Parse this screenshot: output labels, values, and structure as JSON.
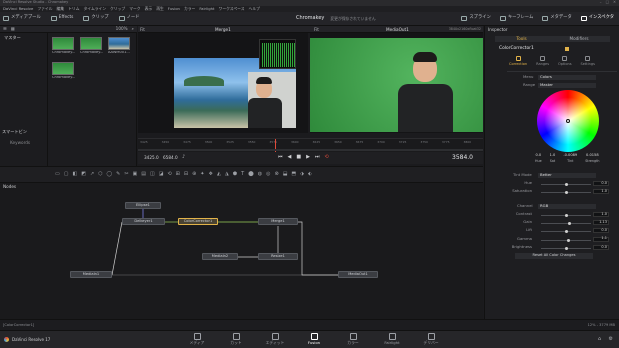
{
  "window": {
    "title": "DaVinci Resolve Studio - Chromakey",
    "controls": [
      "–",
      "□",
      "✕"
    ]
  },
  "menu": {
    "items": [
      "DaVinci Resolve",
      "ファイル",
      "編集",
      "トリム",
      "タイムライン",
      "クリップ",
      "マーク",
      "表示",
      "再生",
      "Fusion",
      "カラー",
      "Fairlight",
      "ワークスペース",
      "ヘルプ"
    ]
  },
  "toolbar": {
    "left": [
      {
        "label": "メディアプール",
        "icon": "media-pool-icon"
      },
      {
        "label": "Effects",
        "icon": "effects-icon"
      },
      {
        "label": "クリップ",
        "icon": "clips-icon"
      },
      {
        "label": "ノード",
        "icon": "nodes-icon"
      }
    ],
    "project_name": "Chromakey",
    "project_status": "変更が保存されていません",
    "right": [
      {
        "label": "スプライン",
        "icon": "spline-icon"
      },
      {
        "label": "キーフレーム",
        "icon": "keyframes-icon"
      },
      {
        "label": "メタデータ",
        "icon": "metadata-icon"
      },
      {
        "label": "インスペクタ",
        "icon": "inspector-icon"
      }
    ]
  },
  "mediapool": {
    "header_zoom": "100%",
    "bin_master": "マスター",
    "bin_smart": "スマートビン",
    "smart_keywords": "Keywords",
    "clips": [
      {
        "name": "Chromakey...",
        "thumb": "green"
      },
      {
        "name": "Chromakey...",
        "thumb": "green"
      },
      {
        "name": "AAWM001...",
        "thumb": "ocean"
      },
      {
        "name": "Chromakey...",
        "thumb": "green"
      }
    ]
  },
  "viewers": {
    "left_title": "Merge1",
    "right_title": "MediaOut1",
    "zoom_left": "Fit",
    "zoom_right": "Fit",
    "resolution": "3840x2160xfloat32"
  },
  "timeline": {
    "ticks": [
      "3425",
      "3450",
      "3475",
      "3500",
      "3525",
      "3550",
      "3575",
      "3600",
      "3625",
      "3650",
      "3675",
      "3700",
      "3725",
      "3750",
      "3775",
      "3800"
    ],
    "current_time": "3584.0",
    "start": "3425.0",
    "end": "6584.0"
  },
  "nodes": {
    "title": "Nodes",
    "items": [
      {
        "name": "Ellipse1"
      },
      {
        "name": "Delkeyer1"
      },
      {
        "name": "ColorCorrector1",
        "selected": true
      },
      {
        "name": "Merge1"
      },
      {
        "name": "MediaIn2"
      },
      {
        "name": "Resize1"
      },
      {
        "name": "MediaIn1"
      },
      {
        "name": "MediaOut1"
      }
    ]
  },
  "inspector": {
    "title": "Inspector",
    "tab_tools": "Tools",
    "tab_modifiers": "Modifiers",
    "node_name": "ColorCorrector1",
    "subtabs": [
      "Correction",
      "Ranges",
      "Options",
      "Settings"
    ],
    "menu_label": "Menu",
    "menu_value": "Colors",
    "range_label": "Range",
    "range_value": "Master",
    "wheel_values": [
      {
        "label": "Hue",
        "value": "0.0"
      },
      {
        "label": "Sat",
        "value": "1.0"
      },
      {
        "label": "Tint",
        "value": "-0.0089"
      },
      {
        "label": "Strength",
        "value": "0.0158"
      }
    ],
    "tint_mode": {
      "label": "Tint Mode",
      "value": "Better"
    },
    "sliders1": [
      {
        "label": "Hue",
        "value": "0.0",
        "level": 0.5
      },
      {
        "label": "Saturation",
        "value": "1.0",
        "level": 0.5
      }
    ],
    "channel": {
      "label": "Channel",
      "value": "RGB"
    },
    "sliders2": [
      {
        "label": "Contrast",
        "value": "1.0",
        "level": 0.5
      },
      {
        "label": "Gain",
        "value": "1.13",
        "level": 0.56
      },
      {
        "label": "Lift",
        "value": "0.0",
        "level": 0.5
      },
      {
        "label": "Gamma",
        "value": "1.1",
        "level": 0.55
      },
      {
        "label": "Brightness",
        "value": "0.0",
        "level": 0.5
      }
    ],
    "reset_button": "Reset All Color Changes"
  },
  "status": {
    "left": "[ColorCorrector1]",
    "right": "12% - 3779 MB"
  },
  "pages": {
    "app_name": "DaVinci Resolve 17",
    "items": [
      {
        "label": "メディア"
      },
      {
        "label": "カット"
      },
      {
        "label": "エディット"
      },
      {
        "label": "Fusion",
        "active": true
      },
      {
        "label": "カラー"
      },
      {
        "label": "Fairlight"
      },
      {
        "label": "デリバー"
      }
    ]
  },
  "colors": {
    "accent": "#e2b34a",
    "green_screen": "#3d9e4a",
    "active_red": "#d84a3c"
  }
}
